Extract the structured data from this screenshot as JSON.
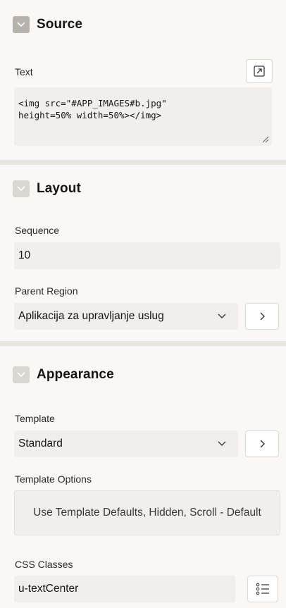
{
  "source": {
    "title": "Source",
    "text_label": "Text",
    "text_value": "<img src=\"#APP_IMAGES#b.jpg\"\nheight=50% width=50%></img>",
    "expand_icon": "expand-icon",
    "resize_icon": "resize-grip-icon"
  },
  "layout": {
    "title": "Layout",
    "sequence_label": "Sequence",
    "sequence_value": "10",
    "parent_region_label": "Parent Region",
    "parent_region_value": "Aplikacija za upravljanje uslug"
  },
  "appearance": {
    "title": "Appearance",
    "template_label": "Template",
    "template_value": "Standard",
    "template_options_label": "Template Options",
    "template_options_value": "Use Template Defaults, Hidden, Scroll - Default",
    "css_classes_label": "CSS Classes",
    "css_classes_value": "u-textCenter"
  },
  "colors": {
    "panel": "#f9f8f6",
    "field": "#f1efed",
    "separator": "#e9e6e2"
  }
}
